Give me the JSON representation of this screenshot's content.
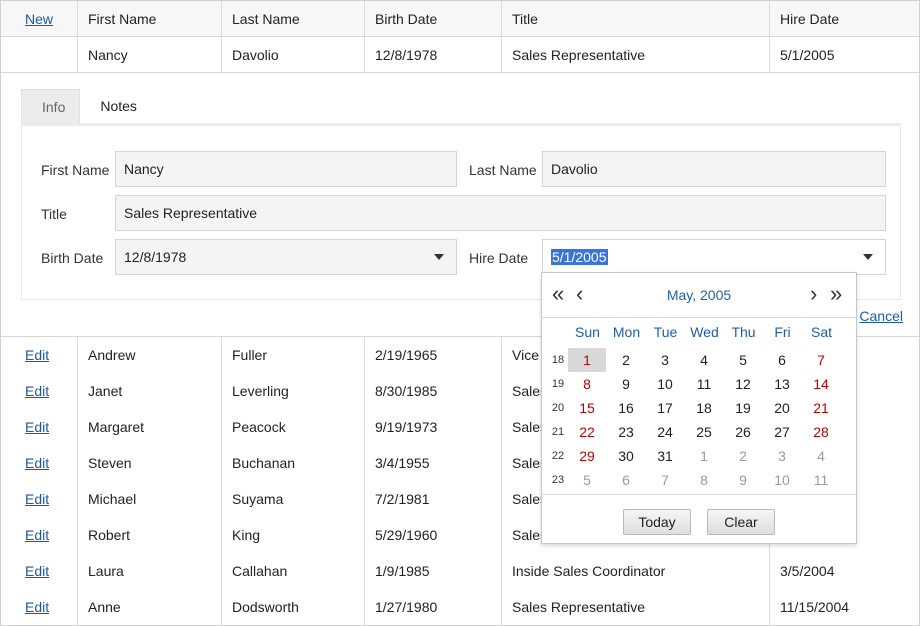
{
  "header": {
    "new_link": "New",
    "columns": [
      "First Name",
      "Last Name",
      "Birth Date",
      "Title",
      "Hire Date"
    ]
  },
  "edit_row": {
    "first": "Nancy",
    "last": "Davolio",
    "birth": "12/8/1978",
    "title": "Sales Representative",
    "hire": "5/1/2005"
  },
  "form": {
    "tabs": [
      "Info",
      "Notes"
    ],
    "first_name_label": "First Name",
    "first_name_value": "Nancy",
    "last_name_label": "Last Name",
    "last_name_value": "Davolio",
    "title_label": "Title",
    "title_value": "Sales Representative",
    "birth_date_label": "Birth Date",
    "birth_date_value": "12/8/1978",
    "hire_date_label": "Hire Date",
    "hire_date_value": "5/1/2005",
    "cancel_link": "Cancel",
    "update_fragment": "e"
  },
  "rows": [
    {
      "action": "Edit",
      "first": "Andrew",
      "last": "Fuller",
      "birth": "2/19/1965",
      "title": "Vice",
      "hire": ""
    },
    {
      "action": "Edit",
      "first": "Janet",
      "last": "Leverling",
      "birth": "8/30/1985",
      "title": "Sales",
      "hire": ""
    },
    {
      "action": "Edit",
      "first": "Margaret",
      "last": "Peacock",
      "birth": "9/19/1973",
      "title": "Sales",
      "hire": ""
    },
    {
      "action": "Edit",
      "first": "Steven",
      "last": "Buchanan",
      "birth": "3/4/1955",
      "title": "Sales",
      "hire": ""
    },
    {
      "action": "Edit",
      "first": "Michael",
      "last": "Suyama",
      "birth": "7/2/1981",
      "title": "Sales",
      "hire": ""
    },
    {
      "action": "Edit",
      "first": "Robert",
      "last": "King",
      "birth": "5/29/1960",
      "title": "Sales",
      "hire": ""
    },
    {
      "action": "Edit",
      "first": "Laura",
      "last": "Callahan",
      "birth": "1/9/1985",
      "title": "Inside Sales Coordinator",
      "hire": "3/5/2004"
    },
    {
      "action": "Edit",
      "first": "Anne",
      "last": "Dodsworth",
      "birth": "1/27/1980",
      "title": "Sales Representative",
      "hire": "11/15/2004"
    }
  ],
  "calendar": {
    "title": "May, 2005",
    "nav_prev_year": "«",
    "nav_prev_month": "‹",
    "nav_next_month": "›",
    "nav_next_year": "»",
    "days_of_week": [
      "Sun",
      "Mon",
      "Tue",
      "Wed",
      "Thu",
      "Fri",
      "Sat"
    ],
    "weeks": [
      {
        "num": "18",
        "days": [
          {
            "d": "1",
            "kind": "sel"
          },
          {
            "d": "2",
            "kind": ""
          },
          {
            "d": "3",
            "kind": ""
          },
          {
            "d": "4",
            "kind": ""
          },
          {
            "d": "5",
            "kind": ""
          },
          {
            "d": "6",
            "kind": ""
          },
          {
            "d": "7",
            "kind": "we"
          }
        ]
      },
      {
        "num": "19",
        "days": [
          {
            "d": "8",
            "kind": "we"
          },
          {
            "d": "9",
            "kind": ""
          },
          {
            "d": "10",
            "kind": ""
          },
          {
            "d": "11",
            "kind": ""
          },
          {
            "d": "12",
            "kind": ""
          },
          {
            "d": "13",
            "kind": ""
          },
          {
            "d": "14",
            "kind": "we"
          }
        ]
      },
      {
        "num": "20",
        "days": [
          {
            "d": "15",
            "kind": "we"
          },
          {
            "d": "16",
            "kind": ""
          },
          {
            "d": "17",
            "kind": ""
          },
          {
            "d": "18",
            "kind": ""
          },
          {
            "d": "19",
            "kind": ""
          },
          {
            "d": "20",
            "kind": ""
          },
          {
            "d": "21",
            "kind": "we"
          }
        ]
      },
      {
        "num": "21",
        "days": [
          {
            "d": "22",
            "kind": "we"
          },
          {
            "d": "23",
            "kind": ""
          },
          {
            "d": "24",
            "kind": ""
          },
          {
            "d": "25",
            "kind": ""
          },
          {
            "d": "26",
            "kind": ""
          },
          {
            "d": "27",
            "kind": ""
          },
          {
            "d": "28",
            "kind": "we"
          }
        ]
      },
      {
        "num": "22",
        "days": [
          {
            "d": "29",
            "kind": "we"
          },
          {
            "d": "30",
            "kind": ""
          },
          {
            "d": "31",
            "kind": ""
          },
          {
            "d": "1",
            "kind": "oth"
          },
          {
            "d": "2",
            "kind": "oth"
          },
          {
            "d": "3",
            "kind": "oth"
          },
          {
            "d": "4",
            "kind": "oth"
          }
        ]
      },
      {
        "num": "23",
        "days": [
          {
            "d": "5",
            "kind": "oth"
          },
          {
            "d": "6",
            "kind": "oth"
          },
          {
            "d": "7",
            "kind": "oth"
          },
          {
            "d": "8",
            "kind": "oth"
          },
          {
            "d": "9",
            "kind": "oth"
          },
          {
            "d": "10",
            "kind": "oth"
          },
          {
            "d": "11",
            "kind": "oth"
          }
        ]
      }
    ],
    "today_button": "Today",
    "clear_button": "Clear"
  },
  "colors": {
    "link": "#1a5aa6",
    "weekend": "#c00000",
    "selection": "#3875d7",
    "calendar_header": "#1f5fa8"
  }
}
